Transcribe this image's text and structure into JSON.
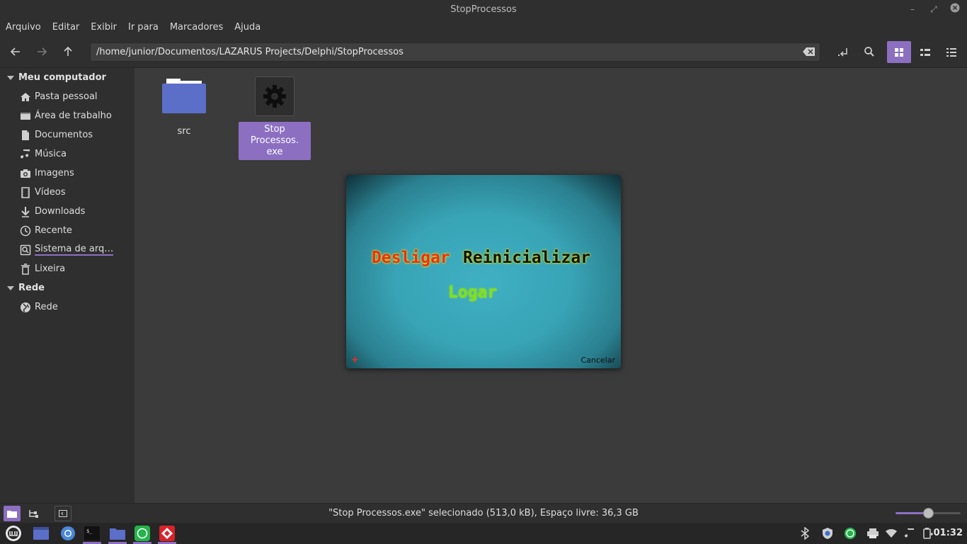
{
  "window": {
    "title": "StopProcessos"
  },
  "menu": [
    "Arquivo",
    "Editar",
    "Exibir",
    "Ir para",
    "Marcadores",
    "Ajuda"
  ],
  "location": {
    "path": "/home/junior/Documentos/LAZARUS Projects/Delphi/StopProcessos"
  },
  "sidebar": {
    "sections": [
      {
        "title": "Meu computador",
        "items": [
          {
            "label": "Pasta pessoal",
            "icon": "home-icon"
          },
          {
            "label": "Área de trabalho",
            "icon": "desktop-icon"
          },
          {
            "label": "Documentos",
            "icon": "document-icon"
          },
          {
            "label": "Música",
            "icon": "music-icon"
          },
          {
            "label": "Imagens",
            "icon": "camera-icon"
          },
          {
            "label": "Vídeos",
            "icon": "film-icon"
          },
          {
            "label": "Downloads",
            "icon": "download-icon"
          },
          {
            "label": "Recente",
            "icon": "clock-icon"
          },
          {
            "label": "Sistema de arq…",
            "icon": "drive-icon"
          },
          {
            "label": "Lixeira",
            "icon": "trash-icon"
          }
        ]
      },
      {
        "title": "Rede",
        "items": [
          {
            "label": "Rede",
            "icon": "network-icon"
          }
        ]
      }
    ]
  },
  "files": [
    {
      "name": "src",
      "type": "folder",
      "selected": false
    },
    {
      "name": "Stop Processos.\nexe",
      "type": "executable",
      "selected": true
    }
  ],
  "popup": {
    "desligar": "Desligar",
    "reinicializar": "Reinicializar",
    "logar": "Logar",
    "cancelar": "Cancelar",
    "plus": "+"
  },
  "status": {
    "text": "\"Stop Processos.exe\" selecionado (513,0 kB), Espaço livre: 36,3 GB",
    "zoom_fraction": 0.5
  },
  "taskbar": {
    "clock": "01:32"
  },
  "colors": {
    "accent": "#8c6fc1",
    "folder": "#5b6fc9"
  }
}
